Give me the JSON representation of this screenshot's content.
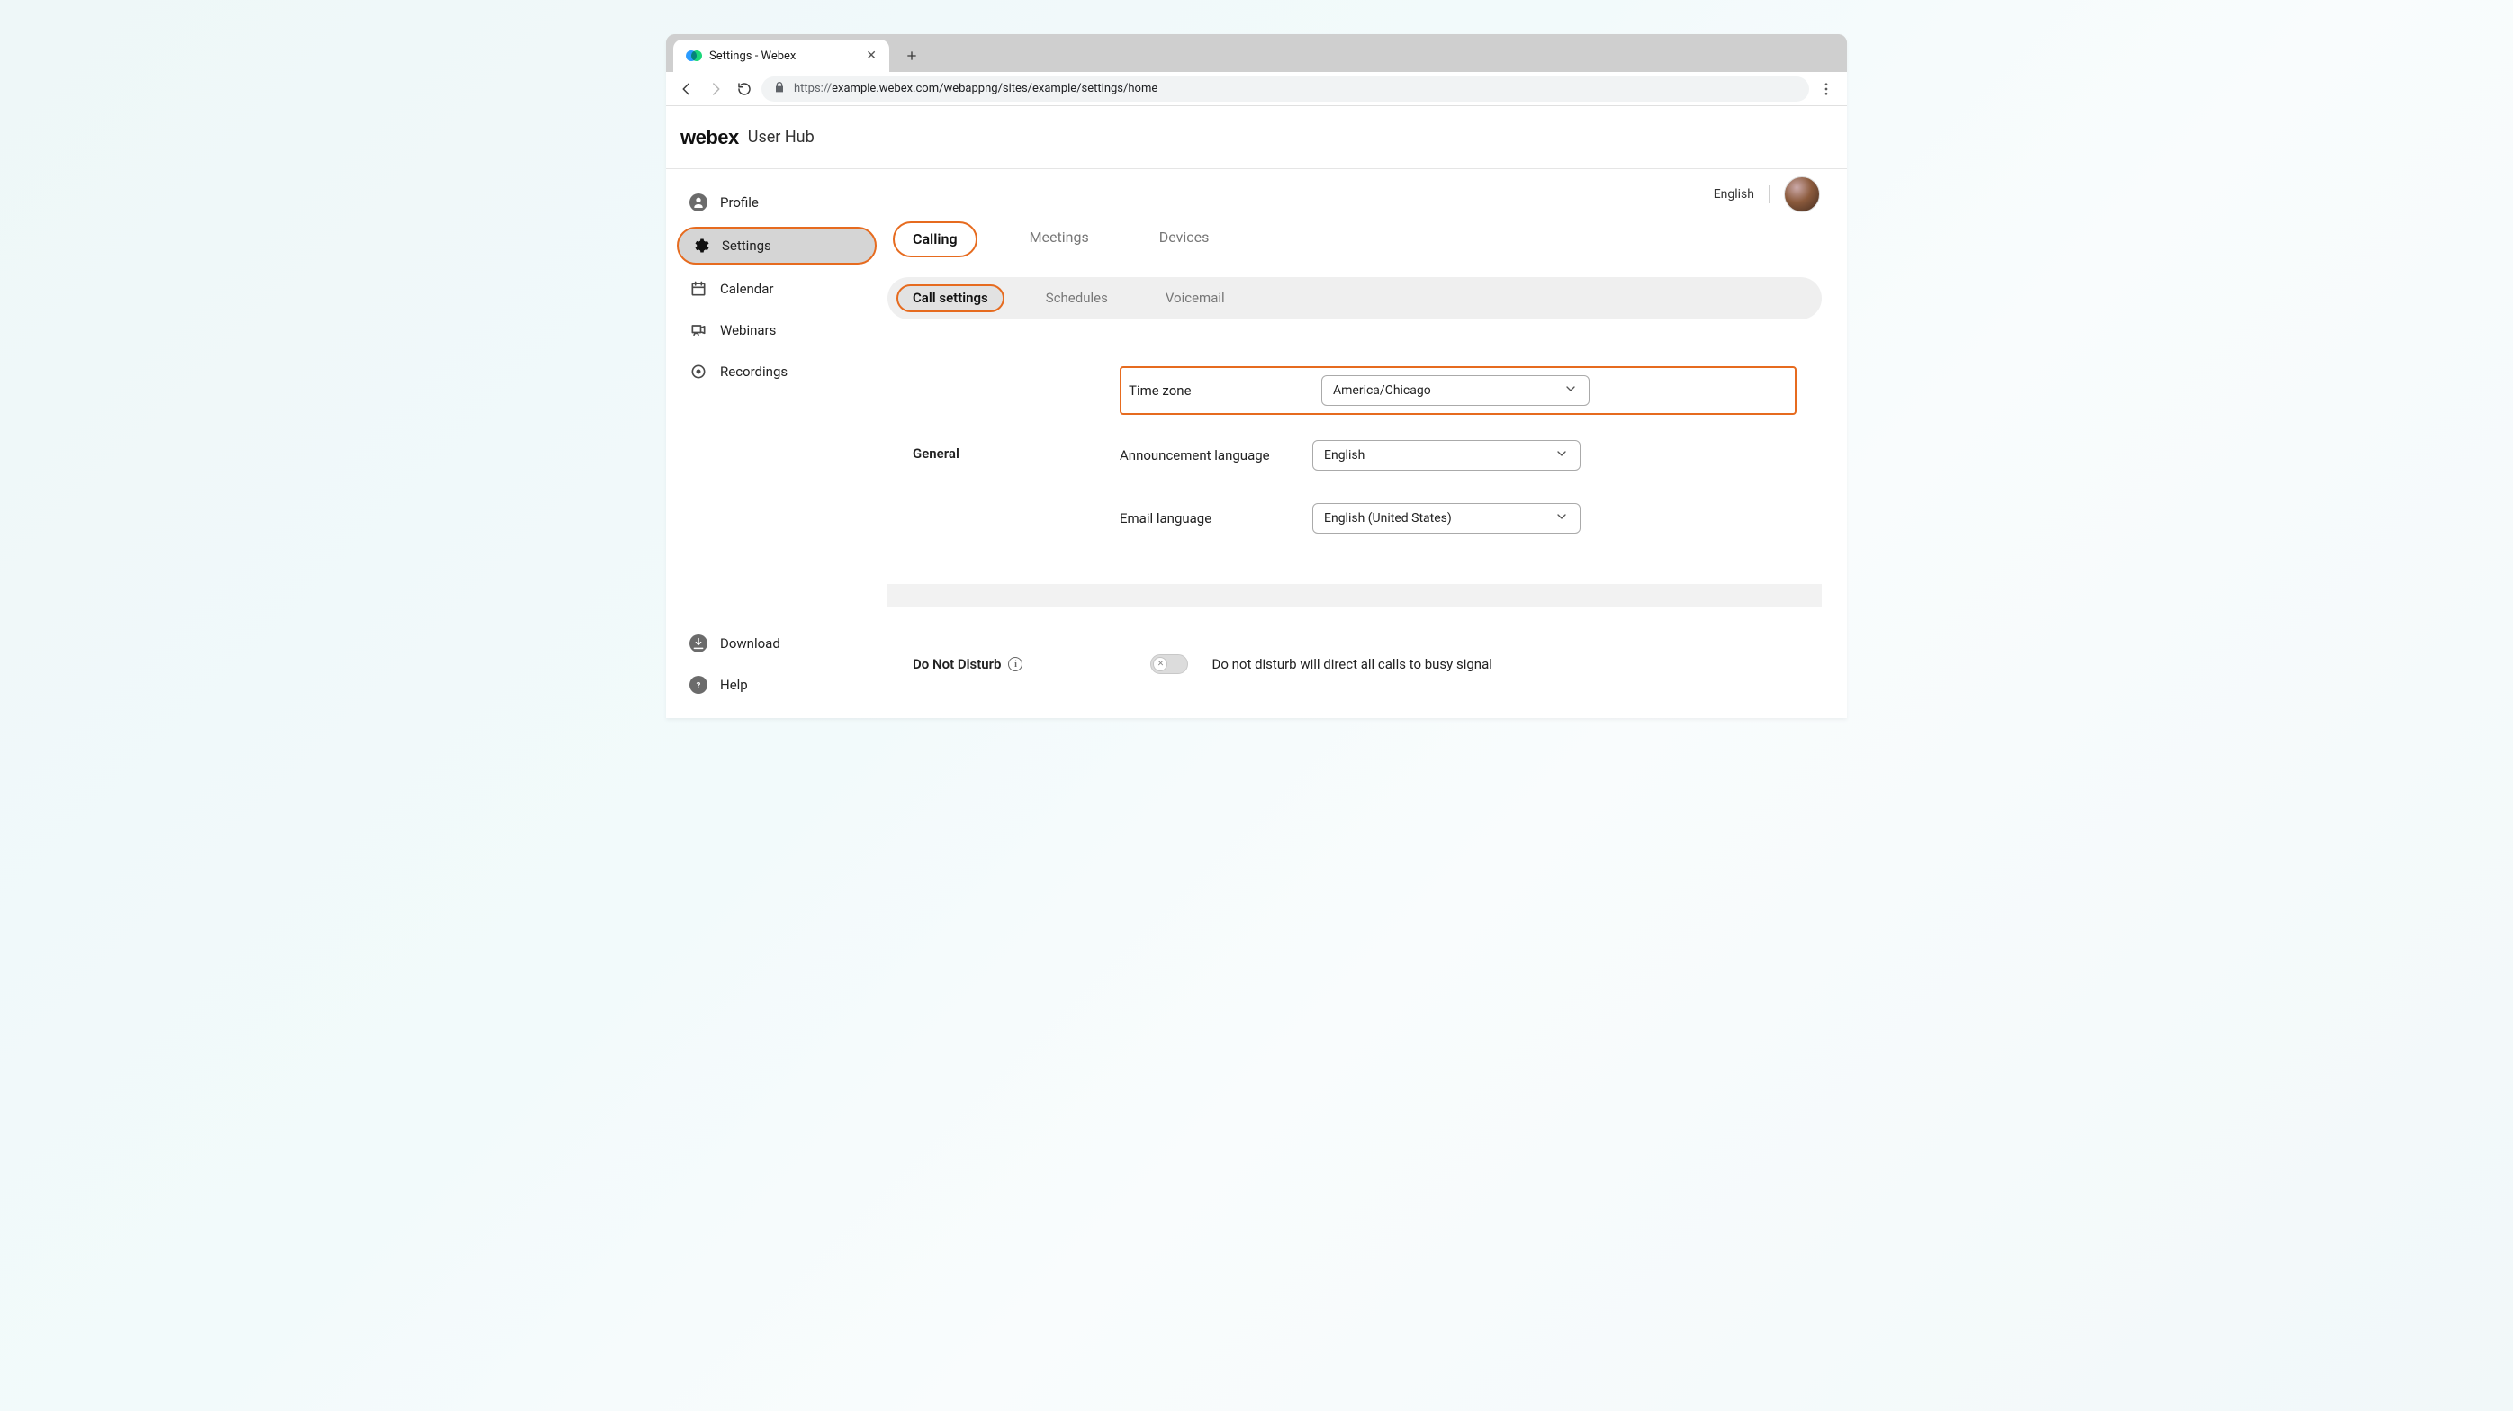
{
  "browser": {
    "tab_title": "Settings - Webex",
    "url_prefix": "https://",
    "url_rest": "example.webex.com/webappng/sites/example/settings/home"
  },
  "header": {
    "brand": "webex",
    "sub": "User Hub"
  },
  "sidebar": {
    "items": [
      {
        "label": "Profile"
      },
      {
        "label": "Settings"
      },
      {
        "label": "Calendar"
      },
      {
        "label": "Webinars"
      },
      {
        "label": "Recordings"
      }
    ],
    "footer": [
      {
        "label": "Download"
      },
      {
        "label": "Help"
      }
    ]
  },
  "topright": {
    "language": "English"
  },
  "tabs": {
    "main": [
      {
        "label": "Calling"
      },
      {
        "label": "Meetings"
      },
      {
        "label": "Devices"
      }
    ],
    "sub": [
      {
        "label": "Call settings"
      },
      {
        "label": "Schedules"
      },
      {
        "label": "Voicemail"
      }
    ]
  },
  "sections": {
    "general_title": "General",
    "fields": {
      "timezone": {
        "label": "Time zone",
        "value": "America/Chicago"
      },
      "announcement": {
        "label": "Announcement language",
        "value": "English"
      },
      "email_lang": {
        "label": "Email language",
        "value": "English (United States)"
      }
    },
    "dnd_title": "Do Not Disturb",
    "dnd_text": "Do not disturb will direct all calls to busy signal"
  }
}
